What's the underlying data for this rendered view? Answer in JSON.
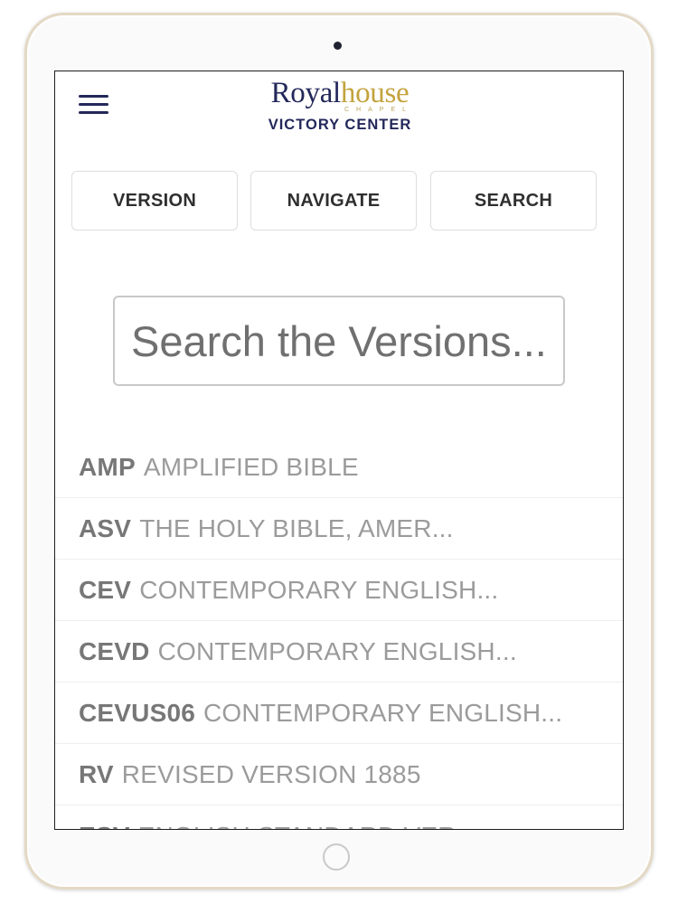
{
  "app": {
    "logo": {
      "word_part1": "Royal",
      "word_part2": "house",
      "chapel_text": "CHAPEL",
      "subtitle": "VICTORY CENTER"
    },
    "colors": {
      "brand_navy": "#23285a",
      "brand_gold": "#c3a33e"
    }
  },
  "menu": {
    "icon": "hamburger-menu-icon"
  },
  "tabs": [
    {
      "label": "VERSION"
    },
    {
      "label": "NAVIGATE"
    },
    {
      "label": "SEARCH"
    }
  ],
  "search": {
    "placeholder": "Search the Versions...",
    "value": ""
  },
  "versions": [
    {
      "abbr": "AMP",
      "name": "AMPLIFIED BIBLE"
    },
    {
      "abbr": "ASV",
      "name": "THE HOLY BIBLE, AMER..."
    },
    {
      "abbr": "CEV",
      "name": "CONTEMPORARY ENGLISH..."
    },
    {
      "abbr": "CEVD",
      "name": "CONTEMPORARY ENGLISH..."
    },
    {
      "abbr": "CEVUS06",
      "name": "CONTEMPORARY ENGLISH..."
    },
    {
      "abbr": "RV",
      "name": "REVISED VERSION 1885"
    },
    {
      "abbr": "ESV",
      "name": "ENGLISH STANDARD VER..."
    }
  ]
}
